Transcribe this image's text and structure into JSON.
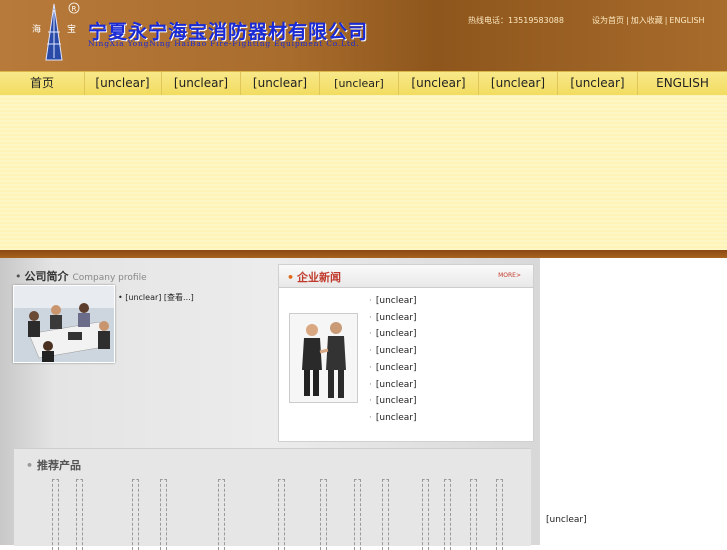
{
  "header": {
    "company_cn": "宁夏永宁海宝消防器材有限公司",
    "company_en": "NingXia YongNing HaiBao Fire-Fighting Equipment Co.Ltd.",
    "hotline": "热线电话：13519583088",
    "links": [
      "设为首页",
      "加入收藏",
      "ENGLISH"
    ],
    "logo_glyphs": [
      "海",
      "宝",
      "R"
    ]
  },
  "nav": {
    "items": [
      "首页",
      "[unclear]",
      "[unclear]",
      "[unclear]",
      "[unclear]",
      "[unclear]",
      "[unclear]",
      "[unclear]",
      "ENGLISH"
    ]
  },
  "profile": {
    "title": "公司简介",
    "title_en": "Company profile",
    "bullet": "•",
    "text": "[unclear] [查看...]"
  },
  "news": {
    "title": "企业新闻",
    "more": "MORE>",
    "items": [
      "[unclear]",
      "[unclear]",
      "[unclear]",
      "[unclear]",
      "[unclear]",
      "[unclear]",
      "[unclear]",
      "[unclear]"
    ]
  },
  "recommend": {
    "title": "推荐产品"
  },
  "footer": {
    "address": "[unclear]"
  },
  "colors": {
    "header_brown": "#a86c2c",
    "nav_yellow": "#f2dc60",
    "banner_yellow": "#fff4b8",
    "title_blue": "#1a2bd6",
    "news_red": "#c0392b"
  }
}
